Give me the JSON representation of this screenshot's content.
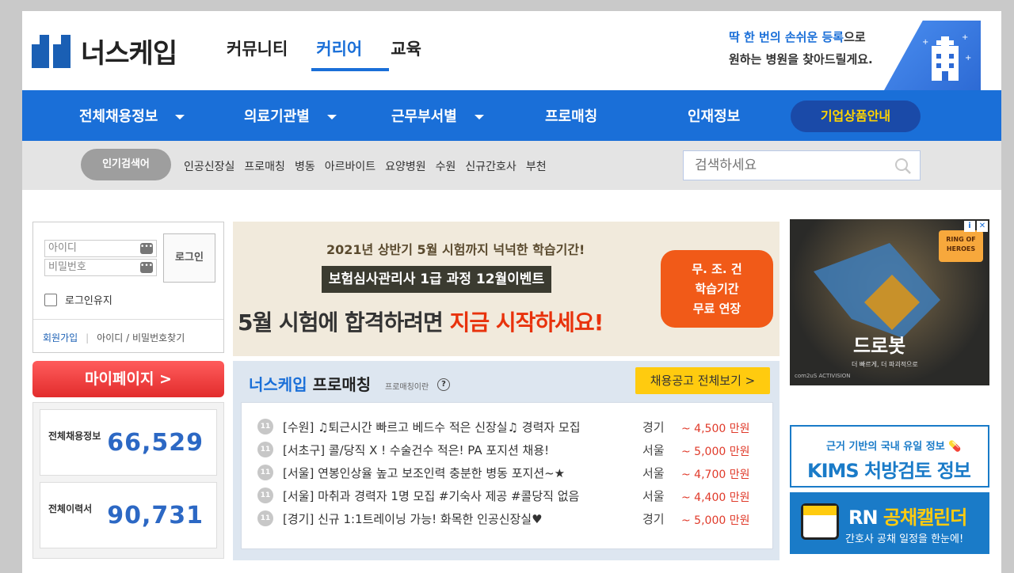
{
  "header": {
    "logo_text": "너스케입",
    "tabs": [
      "커뮤니티",
      "커리어",
      "교육"
    ],
    "active_tab": "커리어",
    "banner": {
      "line1_blue": "딱 한 번의 손쉬운 등록",
      "line1_rest": "으로",
      "line2": "원하는 병원을 찾아드릴게요."
    }
  },
  "nav": {
    "items": [
      {
        "label": "전체채용정보",
        "dropdown": true
      },
      {
        "label": "의료기관별",
        "dropdown": true
      },
      {
        "label": "근무부서별",
        "dropdown": true
      },
      {
        "label": "프로매칭",
        "dropdown": false
      },
      {
        "label": "인재정보",
        "dropdown": false
      }
    ],
    "biz_button": "기업상품안내"
  },
  "search": {
    "popular_label": "인기검색어",
    "keywords": [
      "인공신장실",
      "프로매칭",
      "병동",
      "아르바이트",
      "요양병원",
      "수원",
      "신규간호사",
      "부천"
    ],
    "placeholder": "검색하세요"
  },
  "login": {
    "id_placeholder": "아이디",
    "pw_placeholder": "비밀번호",
    "login_button": "로그인",
    "keep_login": "로그인유지",
    "join": "회원가입",
    "find": "아이디 / 비밀번호찾기"
  },
  "mypage": {
    "label": "마이페이지 >"
  },
  "stats": [
    {
      "label": "전체채용정보",
      "value": "66,529"
    },
    {
      "label": "전체이력서",
      "value": "90,731"
    }
  ],
  "ad_banner": {
    "line1": "2021년 상반기 5월 시험까지 넉넉한 학습기간!",
    "line2": "보험심사관리사 1급 과정 12월이벤트",
    "line3_black": "5월 시험에 합격하려면 ",
    "line3_red": "지금 시작하세요!",
    "badge": [
      "무. 조. 건",
      "학습기간",
      "무료 연장"
    ]
  },
  "promatch": {
    "title_blue": "너스케입",
    "title_black": " 프로매칭",
    "sub": "프로매칭이란",
    "help": "?",
    "view_all": "채용공고 전체보기 >",
    "jobs": [
      {
        "title": "[수원] ♫퇴근시간 빠르고 베드수 적은 신장실♫ 경력자 모집",
        "location": "경기",
        "salary": "~ 4,500 만원"
      },
      {
        "title": "[서초구] 콜/당직 X ! 수술건수 적은! PA 포지션 채용!",
        "location": "서울",
        "salary": "~ 5,000 만원"
      },
      {
        "title": "[서울] 연봉인상율 높고 보조인력 충분한 병동 포지션~★",
        "location": "서울",
        "salary": "~ 4,700 만원"
      },
      {
        "title": "[서울] 마취과 경력자 1명 모집 #기숙사 제공 #콜당직 없음",
        "location": "서울",
        "salary": "~ 4,400 만원"
      },
      {
        "title": "[경기] 신규 1:1트레이닝 가능! 화목한 인공신장실♥",
        "location": "경기",
        "salary": "~ 5,000 만원"
      }
    ]
  },
  "game_ad": {
    "title": "드로봇",
    "slogan": "더 빠르게, 더 파괴적으로",
    "logo": "RING OF HEROES",
    "publisher": "com2uS ACTIVISION"
  },
  "kims": {
    "line1": "근거 기반의 국내 유일 정보",
    "line2": "KIMS 처방검토 정보"
  },
  "rn": {
    "line1_white": "RN ",
    "line1_yellow": "공채캘린더",
    "line2": "간호사 공채 일정을 한눈에!"
  },
  "colors": {
    "brand_blue": "#1a6fd8",
    "accent_yellow": "#ffcb0f",
    "salary_red": "#e03a2a",
    "mypage_red": "#e22c2c"
  }
}
